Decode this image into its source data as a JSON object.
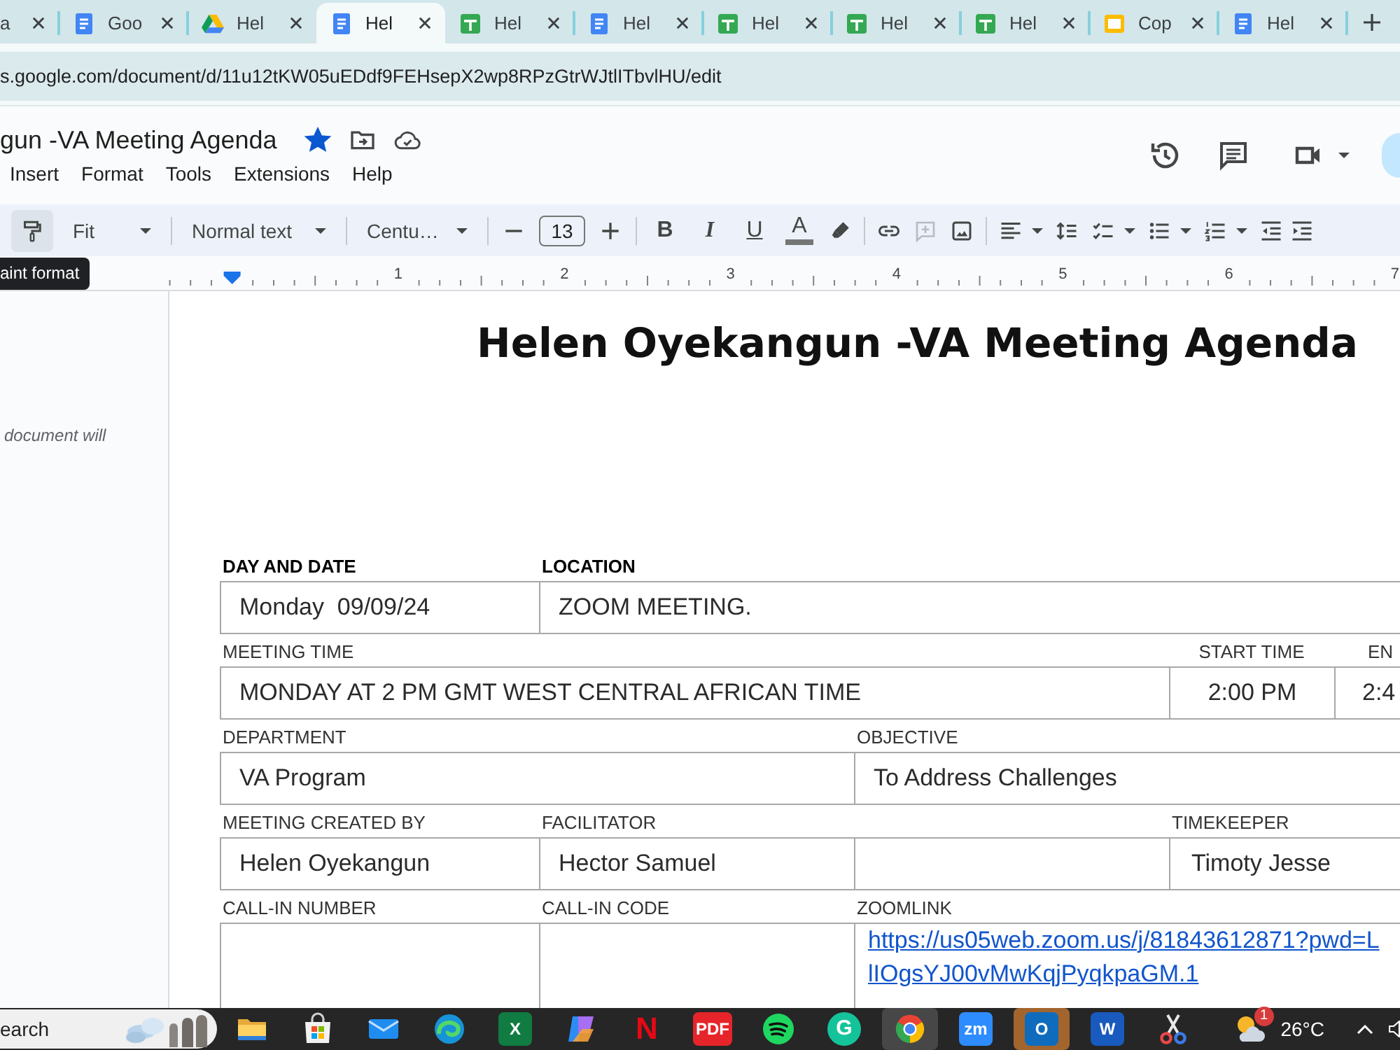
{
  "browser": {
    "tabs": [
      {
        "kind": "plain",
        "label": "a",
        "selected": false
      },
      {
        "kind": "docs",
        "label": "Goo",
        "selected": false
      },
      {
        "kind": "drive",
        "label": "Hel",
        "selected": false
      },
      {
        "kind": "docs",
        "label": "Hel",
        "selected": true
      },
      {
        "kind": "sheets",
        "label": "Hel",
        "selected": false
      },
      {
        "kind": "docs",
        "label": "Hel",
        "selected": false
      },
      {
        "kind": "sheets",
        "label": "Hel",
        "selected": false
      },
      {
        "kind": "sheets",
        "label": "Hel",
        "selected": false
      },
      {
        "kind": "sheets",
        "label": "Hel",
        "selected": false
      },
      {
        "kind": "slides",
        "label": "Cop",
        "selected": false
      },
      {
        "kind": "docs",
        "label": "Hel",
        "selected": false
      }
    ],
    "address": "s.google.com/document/d/11u12tKW05uEDdf9FEHsepX2wp8RPzGtrWJtlITbvlHU/edit"
  },
  "docs": {
    "title": "gun -VA Meeting Agenda",
    "starred": true,
    "menu": [
      "Insert",
      "Format",
      "Tools",
      "Extensions",
      "Help"
    ],
    "toolbar": {
      "paint_format": {
        "hovered": true,
        "tooltip": "aint format"
      },
      "tools": [
        {
          "kind": "zoom",
          "label": "Fit",
          "disabled": false
        },
        {
          "kind": "style",
          "label": "Normal text",
          "disabled": false
        },
        {
          "kind": "font",
          "label": "Centu…",
          "disabled": false
        },
        {
          "kind": "size-down",
          "disabled": false
        },
        {
          "kind": "size",
          "value": "13",
          "disabled": false
        },
        {
          "kind": "size-up",
          "disabled": false
        },
        {
          "kind": "bold",
          "label": "B",
          "disabled": false
        },
        {
          "kind": "italic",
          "label": "I",
          "disabled": false
        },
        {
          "kind": "underline",
          "label": "U",
          "disabled": false
        },
        {
          "kind": "text-color",
          "label": "A",
          "disabled": false
        },
        {
          "kind": "highlight",
          "disabled": false
        },
        {
          "kind": "link",
          "disabled": false
        },
        {
          "kind": "add-comment",
          "disabled": true
        },
        {
          "kind": "image",
          "disabled": false
        },
        {
          "kind": "align",
          "disabled": false
        },
        {
          "kind": "line-spacing",
          "disabled": false
        },
        {
          "kind": "checklist",
          "disabled": false
        },
        {
          "kind": "bullets",
          "disabled": false
        },
        {
          "kind": "numbered",
          "disabled": false
        },
        {
          "kind": "outdent",
          "disabled": false
        },
        {
          "kind": "indent",
          "disabled": false
        }
      ]
    },
    "ruler": {
      "labels": [
        "1",
        "2",
        "3",
        "4",
        "5",
        "6",
        "7"
      ]
    },
    "outline_hint": "document will"
  },
  "document": {
    "title": "Helen Oyekangun -VA Meeting Agenda",
    "rows": [
      {
        "labels": [
          "DAY AND DATE",
          "LOCATION"
        ],
        "values": [
          {
            "kind": "text",
            "text": "Monday  09/09/24"
          },
          {
            "kind": "text",
            "text": "ZOOM MEETING."
          }
        ]
      },
      {
        "labels": [
          "MEETING TIME",
          "START TIME",
          "EN"
        ],
        "values": [
          {
            "kind": "text",
            "text": "MONDAY AT 2 PM GMT WEST CENTRAL AFRICAN TIME"
          },
          {
            "kind": "text",
            "text": "2:00 PM"
          },
          {
            "kind": "text",
            "text": "2:4"
          }
        ]
      },
      {
        "labels": [
          "DEPARTMENT",
          "OBJECTIVE"
        ],
        "values": [
          {
            "kind": "text",
            "text": "VA Program"
          },
          {
            "kind": "text",
            "text": "To Address Challenges"
          }
        ]
      },
      {
        "labels": [
          "MEETING CREATED BY",
          "FACILITATOR",
          "TIMEKEEPER"
        ],
        "values": [
          {
            "kind": "text",
            "text": "Helen Oyekangun"
          },
          {
            "kind": "text",
            "text": "Hector Samuel"
          },
          {
            "kind": "text",
            "text": "Timoty Jesse"
          }
        ]
      },
      {
        "labels": [
          "CALL-IN NUMBER",
          "CALL-IN CODE",
          "ZOOMLINK"
        ],
        "values": [
          {
            "kind": "link",
            "lines": [
              "https://us05web.zoom.us/j/81843612871?pwd=L",
              "lIOgsYJ00vMwKqjPyqkpaGM.1"
            ]
          }
        ]
      }
    ]
  },
  "taskbar": {
    "search": {
      "placeholder": "earch"
    },
    "apps": [
      {
        "kind": "folder",
        "active": false,
        "flashing": false
      },
      {
        "kind": "store",
        "active": false,
        "flashing": false
      },
      {
        "kind": "mail",
        "active": false,
        "flashing": false
      },
      {
        "kind": "swirl",
        "active": false,
        "flashing": false
      },
      {
        "kind": "tile",
        "label": "X",
        "color": "#107c41",
        "active": false,
        "flashing": false
      },
      {
        "kind": "knot",
        "active": false,
        "flashing": false
      },
      {
        "kind": "letter",
        "label": "N",
        "color": "#e50914",
        "active": false,
        "flashing": false
      },
      {
        "kind": "tile",
        "label": "PDF",
        "color": "#e5252a",
        "active": false,
        "flashing": false
      },
      {
        "kind": "waves",
        "active": false,
        "flashing": false
      },
      {
        "kind": "disc",
        "label": "G",
        "color": "#15c39a",
        "active": false,
        "flashing": false
      },
      {
        "kind": "browser",
        "active": true,
        "flashing": false
      },
      {
        "kind": "tile",
        "label": "zm",
        "color": "#2d8cff",
        "active": false,
        "flashing": false
      },
      {
        "kind": "tile",
        "label": "O",
        "color": "#0f6cbd",
        "active": false,
        "flashing": true
      },
      {
        "kind": "tile",
        "label": "W",
        "color": "#185abd",
        "active": false,
        "flashing": false
      },
      {
        "kind": "scissors",
        "active": false,
        "flashing": false
      }
    ],
    "weather": {
      "badge": "1",
      "temperature": "26°C"
    }
  }
}
